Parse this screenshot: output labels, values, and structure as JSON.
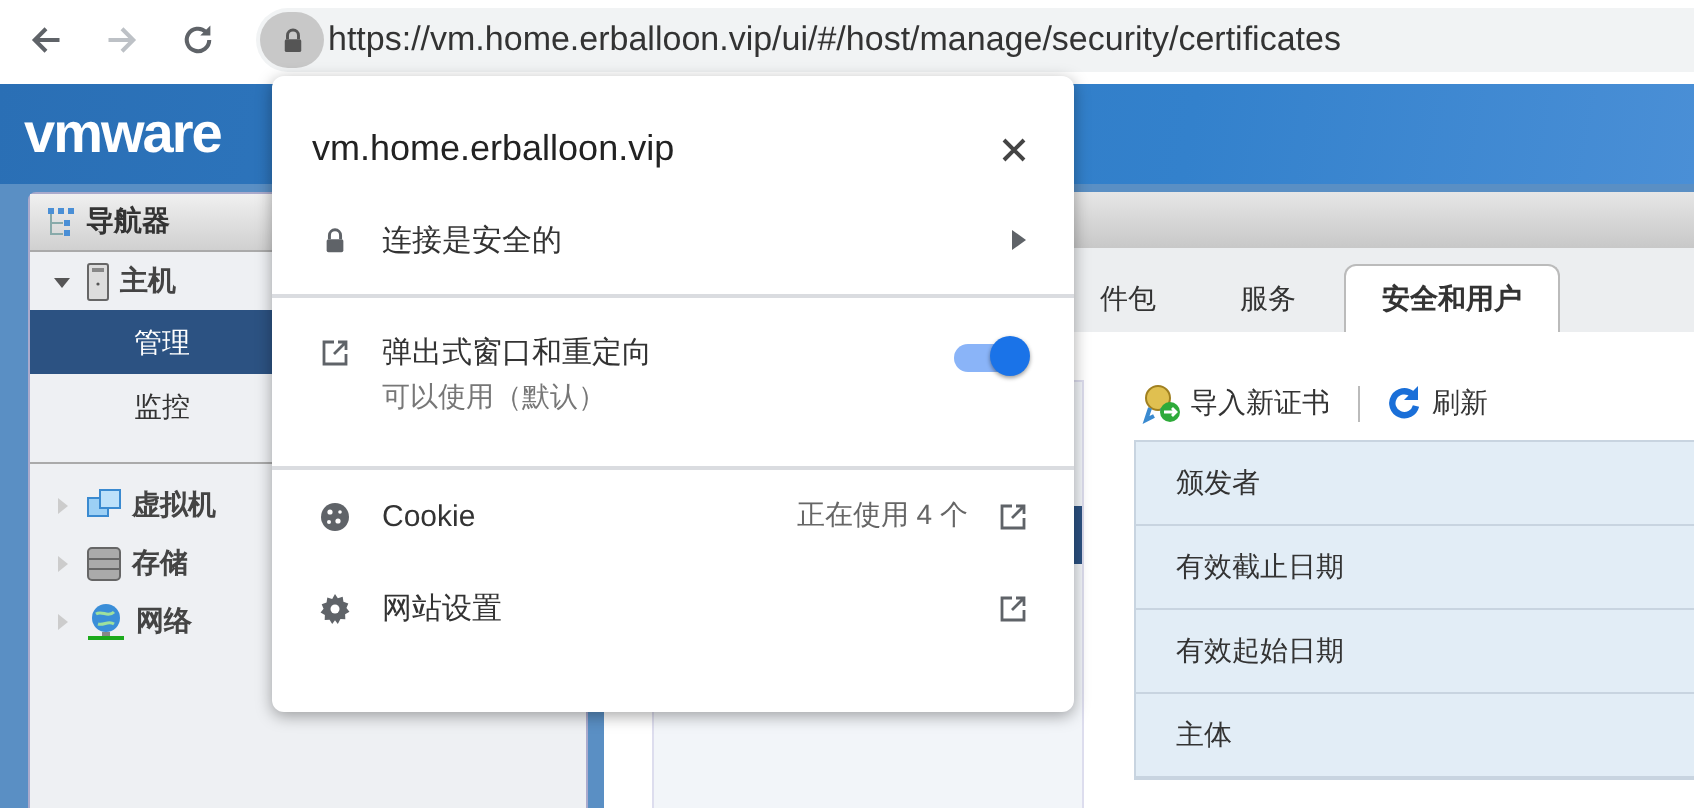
{
  "browser": {
    "url": "https://vm.home.erballoon.vip/ui/#/host/manage/security/certificates"
  },
  "app": {
    "logo": "vmware"
  },
  "navigator": {
    "title": "导航器",
    "items": [
      {
        "kind": "host",
        "label": "主机",
        "expanded": true,
        "children": [
          {
            "label": "管理",
            "selected": true
          },
          {
            "label": "监控",
            "selected": false
          }
        ]
      },
      {
        "kind": "vms",
        "label": "虚拟机",
        "expanded": false
      },
      {
        "kind": "storage",
        "label": "存储",
        "expanded": false
      },
      {
        "kind": "network",
        "label": "网络",
        "expanded": false
      }
    ]
  },
  "tabs": [
    {
      "label": "件包",
      "selected": false
    },
    {
      "label": "服务",
      "selected": false
    },
    {
      "label": "安全和用户",
      "selected": true
    }
  ],
  "toolbar": [
    {
      "kind": "import",
      "label": "导入新证书"
    },
    {
      "kind": "refresh",
      "label": "刷新"
    }
  ],
  "properties": [
    "颁发者",
    "有效截止日期",
    "有效起始日期",
    "主体"
  ],
  "popup": {
    "site": "vm.home.erballoon.vip",
    "rows": [
      {
        "kind": "connection",
        "label": "连接是安全的"
      },
      {
        "kind": "permission",
        "label": "弹出式窗口和重定向",
        "status": "可以使用（默认）",
        "on": true
      },
      {
        "kind": "cookie",
        "label": "Cookie",
        "detail": "正在使用 4 个"
      },
      {
        "kind": "settings",
        "label": "网站设置"
      }
    ]
  }
}
